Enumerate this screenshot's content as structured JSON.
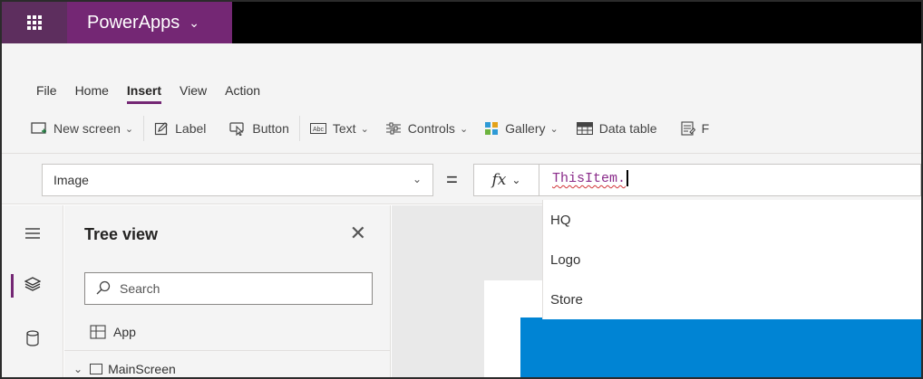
{
  "app": {
    "name": "PowerApps"
  },
  "menu": {
    "tabs": [
      {
        "label": "File"
      },
      {
        "label": "Home"
      },
      {
        "label": "Insert",
        "active": true
      },
      {
        "label": "View"
      },
      {
        "label": "Action"
      }
    ]
  },
  "toolbar": {
    "new_screen": "New screen",
    "label": "Label",
    "button": "Button",
    "text": "Text",
    "controls": "Controls",
    "gallery": "Gallery",
    "data_table": "Data table",
    "forms_partial": "F"
  },
  "formula": {
    "property": "Image",
    "equals": "=",
    "fx": "fx",
    "value": "ThisItem."
  },
  "suggestions": [
    "HQ",
    "Logo",
    "Store"
  ],
  "tree": {
    "title": "Tree view",
    "search_placeholder": "Search",
    "app_label": "App",
    "screen_label": "MainScreen"
  },
  "colors": {
    "brand_purple": "#742774",
    "waffle_purple": "#5d2e5e",
    "canvas_blue": "#0084d4"
  }
}
